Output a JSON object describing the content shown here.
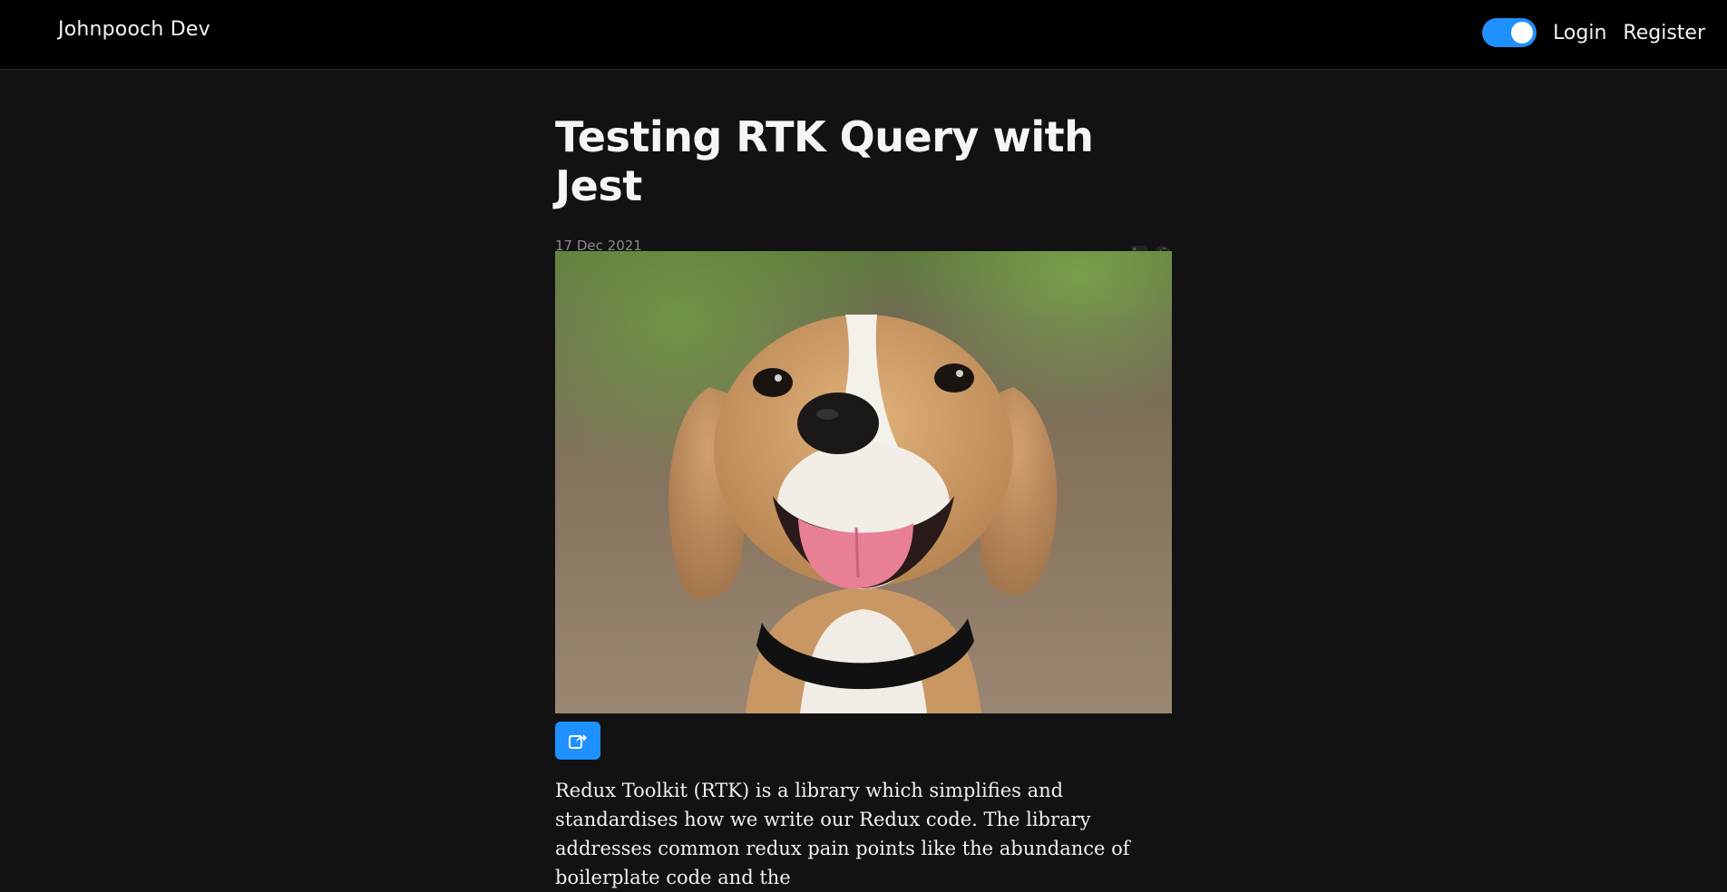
{
  "nav": {
    "brand": "Johnpooch Dev",
    "login": "Login",
    "register": "Register",
    "theme_toggle_on": true
  },
  "article": {
    "title": "Testing RTK Query with Jest",
    "date": "17 Dec 2021",
    "socials": [
      "linkedin-icon",
      "github-icon"
    ],
    "hero_alt": "beagle-photo",
    "intro": "Redux Toolkit (RTK) is a library which simplifies and standardises how we write our Redux code. The library addresses common redux pain points like the abundance of boilerplate code and the"
  },
  "colors": {
    "accent": "#1e90ff",
    "background": "#121212",
    "topbar": "#000000"
  }
}
